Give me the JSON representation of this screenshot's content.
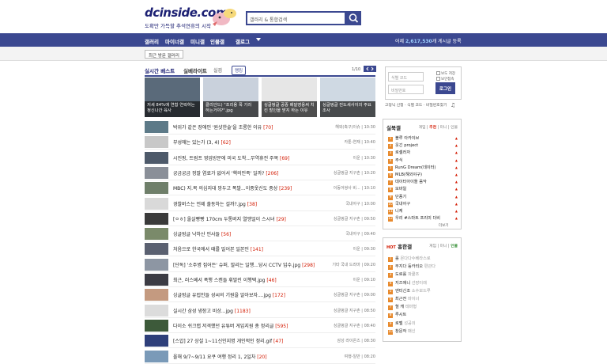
{
  "header": {
    "logo": "dcinside.com",
    "tagline": "도확만 가득할 추석연휴의 시작",
    "search_placeholder": "갤러리 & 통합검색"
  },
  "nav": {
    "items": [
      "갤러리",
      "마이너갤",
      "미니갤",
      "인물갤",
      "갤로그"
    ],
    "right_prefix": "어제 ",
    "right_count": "2,617,530",
    "right_suffix": "개 게시글 등록"
  },
  "sub": {
    "recent_label": "최근 방문 갤러리"
  },
  "realtime": {
    "tab1": "실시간 베스트",
    "tab2": "실베라이트",
    "tab3": "실검",
    "badge": "랭킹",
    "page": "1/10",
    "thumbs": [
      "저세 84%에 연합 연락하는 정신나간 육사",
      "클리안드) \"조리용 폭 기러 하는거야?\".jpg",
      "싱글벙글 공중 배달영웅써 치킨 할인을 받지 하는 이유",
      "싱글벙글 전도세사이의 주요 조사"
    ]
  },
  "rows": [
    {
      "title": "박위가 같은 장애인 '원샷한술'을 조롱한 이유",
      "cnt": "[70]",
      "meta": "해외(축구)이슈 | 10:30",
      "color": "#5d7a88"
    },
    {
      "title": "부성애는 있는가 (3, 4)",
      "cnt": "[62]",
      "meta": "카툰-연재 | 10:40",
      "color": "#c8c8c8"
    },
    {
      "title": "시진핑, 트럼프 영업방문에 미국 도착...무역휴전 주목",
      "cnt": "[69]",
      "meta": "이운 | 10:30",
      "color": "#4e5a6a"
    },
    {
      "title": "궁금궁금 정말 염료가 없어서 '핵의민족' 일까?",
      "cnt": "[206]",
      "meta": "싱글벙글 지구촌 | 10:20",
      "color": "#8a8f98"
    },
    {
      "title": "MBC) 지.복 의심지대 망두고 폭발...이중옷신도 중상",
      "cnt": "[239]",
      "meta": "이동어쌍사 비... | 10:10",
      "color": "#6f7f6a"
    },
    {
      "title": "경찰버스는 언제 출동하는 걸까?.jpg",
      "cnt": "[38]",
      "meta": "국내야구 | 10:00",
      "color": "#d9d9d9"
    },
    {
      "title": "[ㅇㅎ] 올살빵빵 170cm 두통버지 열맹얼이 스시녀",
      "cnt": "[29]",
      "meta": "싱글벙글 지구촌 | 09:50",
      "color": "#3a3a3a"
    },
    {
      "title": "싱글벙글 낙하산 인사들",
      "cnt": "[56]",
      "meta": "국내야구 | 09:40",
      "color": "#7a8a6a"
    },
    {
      "title": "처음으로 한국에서 때를 밀어본 일본인",
      "cnt": "[141]",
      "meta": "이운 | 09:30",
      "color": "#5a6070"
    },
    {
      "title": "[단독] '소주병 집어든' 슈퍼, 말리는 일행...당시 CCTV 입수.jpg",
      "cnt": "[298]",
      "meta": "기타 국내 드라마 | 09:20",
      "color": "#8d96a3"
    },
    {
      "title": "최근, 러스베서 폭행 스캔들 휘말린 이행택.jpg",
      "cnt": "[46]",
      "meta": "이운 | 09:10",
      "color": "#3c3c44"
    },
    {
      "title": "싱글벙글 유럽인들 성씨의 기원을 알아보자....jpg",
      "cnt": "[172]",
      "meta": "싱글벙글 지구촌 | 09:00",
      "color": "#c49a80"
    },
    {
      "title": "실시간 삼성 냉장고 비상...jpg",
      "cnt": "[1183]",
      "meta": "싱글벙글 지구촌 | 08:50",
      "color": "#dcdcdc"
    },
    {
      "title": "다이소 쉬크랩 저격했던 유튜버 게임지원 총 정리글",
      "cnt": "[595]",
      "meta": "싱글벙글 지구촌 | 08:40",
      "color": "#3d5a3a"
    },
    {
      "title": "[스압] 27 상설 1~11신인지명 개인적인 정리.gif",
      "cnt": "[47]",
      "meta": "삼성 라이온즈 | 08:30",
      "color": "#2e3f7a"
    },
    {
      "title": "올해 9/7~9/11 요쿠 여행 정리 1, 2일차",
      "cnt": "[20]",
      "meta": "여행-일반 | 08:20",
      "color": "#7a9ab8"
    }
  ],
  "login": {
    "id_placeholder": "식별 코드",
    "pw_placeholder": "비밀번호",
    "btn": "로그인",
    "opt1": "보도 저장",
    "opt2": "보안접속",
    "links": "고정닉 신청 · 식별 코드 · 비밀번호찾기"
  },
  "rank1": {
    "title": "실북갤",
    "tabs": [
      "게임",
      "추천",
      "미니",
      "인물"
    ],
    "items": [
      "블루 아카이브",
      "웃긴 project",
      "로셀러자",
      "주식",
      "RunG Dream(데이터)",
      "MLB(해외야구)",
      "데이터아이돌 음악",
      "모바일",
      "단풍기",
      "국내야구",
      "니케",
      "우리 #스마트 프리미 더비"
    ],
    "more": "더보기"
  },
  "rank2": {
    "title": "흥한갤",
    "tabs": [
      "게임",
      "미니",
      "인물"
    ],
    "items": [
      "롤",
      "무지다 등카리오",
      "도로롤",
      "지즈애니",
      "엔터신조",
      "최근전",
      "헐 캐",
      "루시트",
      "로벨",
      "창문작"
    ],
    "subs": [
      "몬다다수베라스로",
      "편관다",
      "파쿨조",
      "선장이래",
      "소수보드루",
      "마이너",
      "테마형",
      "",
      "성공의",
      "패신"
    ]
  }
}
